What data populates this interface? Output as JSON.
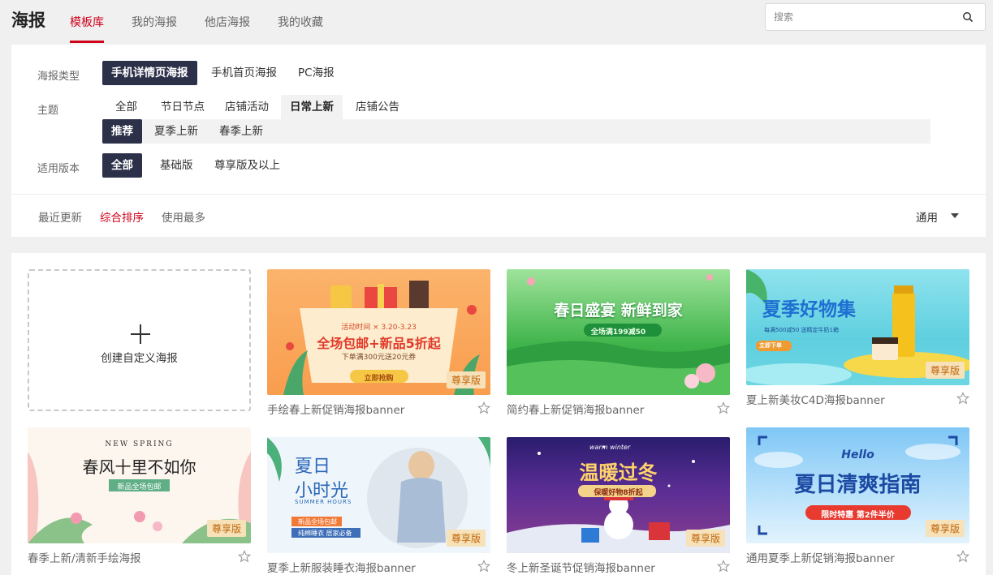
{
  "header": {
    "title": "海报",
    "tabs": [
      {
        "label": "模板库",
        "active": true
      },
      {
        "label": "我的海报",
        "active": false
      },
      {
        "label": "他店海报",
        "active": false
      },
      {
        "label": "我的收藏",
        "active": false
      }
    ],
    "search": {
      "placeholder": "搜索",
      "value": "",
      "icon": "search-icon"
    }
  },
  "filters": {
    "type": {
      "label": "海报类型",
      "options": [
        "手机详情页海报",
        "手机首页海报",
        "PC海报"
      ],
      "selected": "手机详情页海报"
    },
    "theme": {
      "label": "主题",
      "options": [
        "全部",
        "节日节点",
        "店铺活动",
        "日常上新",
        "店铺公告"
      ],
      "selected": "日常上新",
      "sub_options": [
        "推荐",
        "夏季上新",
        "春季上新"
      ],
      "sub_selected": "推荐"
    },
    "edition": {
      "label": "适用版本",
      "options": [
        "全部",
        "基础版",
        "尊享版及以上"
      ],
      "selected": "全部"
    }
  },
  "sort": {
    "options": [
      "最近更新",
      "综合排序",
      "使用最多"
    ],
    "selected": "综合排序",
    "scope": "通用"
  },
  "create_card": {
    "label": "创建自定义海报",
    "icon": "plus-icon"
  },
  "templates": [
    {
      "title": "手绘春上新促销海报banner",
      "badge": "尊享版",
      "banner": {
        "line1": "活动时间 × 3.20-3.23",
        "line2": "全场包邮+新品5折起",
        "line3": "下单满300元送20元券",
        "button": "立即抢购"
      }
    },
    {
      "title": "简约春上新促销海报banner",
      "badge": "",
      "banner": {
        "line1": "春日盛宴  新鲜到家",
        "line2": "全场满199减50"
      }
    },
    {
      "title": "夏上新美妆C4D海报banner",
      "badge": "尊享版",
      "banner": {
        "line1": "夏季好物集",
        "line2": "每满500减50  送精定牛奶1箱",
        "button": "立即下单"
      }
    },
    {
      "title": "春季上新/清新手绘海报",
      "badge": "尊享版",
      "banner": {
        "line1": "NEW SPRING",
        "line2": "春风十里不如你",
        "line3": "新品全场包邮"
      }
    },
    {
      "title": "夏季上新服装睡衣海报banner",
      "badge": "尊享版",
      "banner": {
        "line1": "夏日",
        "line2": "小时光",
        "line3": "SUMMER HOURS",
        "line4": "新品全场包邮",
        "line5": "纯棉睡衣 居家必备"
      }
    },
    {
      "title": "冬上新圣诞节促销海报banner",
      "badge": "尊享版",
      "banner": {
        "line1": "warm winter",
        "line2": "温暖过冬",
        "line3": "保暖好物8折起"
      }
    },
    {
      "title": "通用夏季上新促销海报banner",
      "badge": "尊享版",
      "banner": {
        "line1": "Hello",
        "line2": "夏日清爽指南",
        "line3": "限时特惠 第2件半价"
      }
    }
  ],
  "colors": {
    "accent": "#d0021b",
    "dark_chip": "#2c3149",
    "badge_bg": "#f6e1b8",
    "badge_text": "#c0650a"
  }
}
